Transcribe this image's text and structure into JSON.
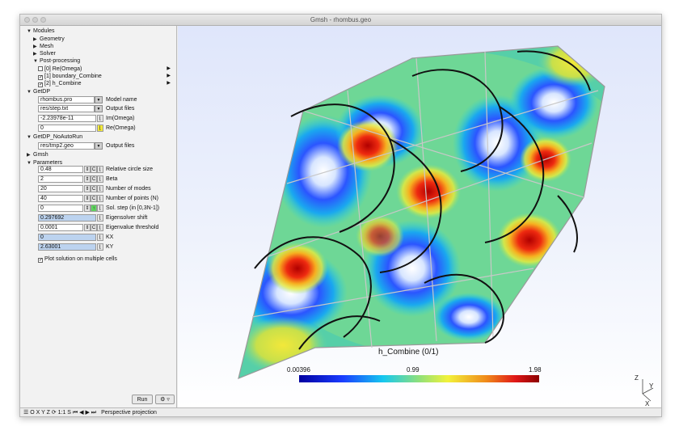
{
  "window": {
    "title": "Gmsh - rhombus.geo"
  },
  "tree": {
    "modules": "Modules",
    "geometry": "Geometry",
    "mesh": "Mesh",
    "solver": "Solver",
    "post_processing": "Post-processing",
    "views": [
      {
        "label": "[0] Re(Omega)",
        "checked": false
      },
      {
        "label": "[1] boundary_Combine",
        "checked": true
      },
      {
        "label": "[2] h_Combine",
        "checked": true
      }
    ],
    "getdp": "GetDP",
    "getdp_noautorun": "GetDP_NoAutoRun",
    "gmsh": "Gmsh",
    "parameters": "Parameters"
  },
  "getdp": {
    "model_name_value": "rhombus.pro",
    "model_name_label": "Model name",
    "output_files_value": "res/step.txt",
    "output_files_label": "Output files",
    "im_omega_value": "-2.23978e-11",
    "im_omega_label": "Im(Omega)",
    "re_omega_value": "0",
    "re_omega_label": "Re(Omega)"
  },
  "getdp_noautorun": {
    "output_files_value": "res/tmp2.geo",
    "output_files_label": "Output files"
  },
  "parameters": [
    {
      "value": "0.48",
      "label": "Relative circle size"
    },
    {
      "value": "2",
      "label": "Beta"
    },
    {
      "value": "20",
      "label": "Number of modes"
    },
    {
      "value": "40",
      "label": "Number of points (N)"
    },
    {
      "value": "0",
      "label": "Sol. step (in [0,3N-1])"
    },
    {
      "value": "0.297692",
      "label": "Eigensolver shift"
    },
    {
      "value": "0.0001",
      "label": "Eigenvalue threshold"
    },
    {
      "value": "0",
      "label": "KX"
    },
    {
      "value": "2.63001",
      "label": "KY"
    }
  ],
  "plot_multiple_cells": "Plot solution on multiple cells",
  "run_label": "Run",
  "settings_label": "⚙ ▿",
  "status": {
    "toolbar": "☰ O X Y Z ⟳ 1:1 S ⏮ ◀ ▶ ⏭",
    "text": "Perspective projection"
  },
  "colorbar": {
    "title": "h_Combine (0/1)",
    "min": "0.00396",
    "mid": "0.99",
    "max": "1.98"
  },
  "axes": {
    "z": "Z",
    "y": "Y",
    "x": "X"
  }
}
